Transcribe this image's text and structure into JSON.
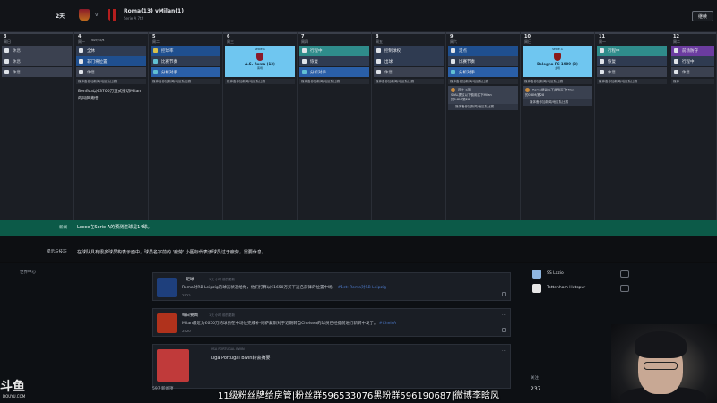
{
  "topbar": {
    "days": "2天",
    "vs": "v",
    "match_title": "Roma(13) vMilan(1)",
    "match_sub": "Serie A 7th",
    "button": "继续"
  },
  "calendar": {
    "days": [
      {
        "num": "3",
        "weekday": "周日",
        "date": "",
        "slots": [
          {
            "kind": "rest",
            "icon": "w",
            "label": "休息"
          },
          {
            "kind": "rest",
            "icon": "w",
            "label": "休息"
          },
          {
            "kind": "rest",
            "icon": "w",
            "label": "休息"
          }
        ],
        "notes": []
      },
      {
        "num": "4",
        "weekday": "周一",
        "date": "2027/10/5",
        "slots": [
          {
            "kind": "train",
            "icon": "w",
            "label": "全休"
          },
          {
            "kind": "dark",
            "icon": "w",
            "label": "非门将位置"
          },
          {
            "kind": "rest",
            "icon": "w",
            "label": "休息"
          }
        ],
        "notes": [
          "媒体备参加新闻/地区队比赛"
        ],
        "text": "Benfica以€3700万正式接切Milan的同萨藏惜"
      },
      {
        "num": "5",
        "weekday": "周二",
        "date": "",
        "slots": [
          {
            "kind": "dark",
            "icon": "y",
            "label": "控球率"
          },
          {
            "kind": "train",
            "icon": "c",
            "label": "比赛节奏"
          },
          {
            "kind": "blue",
            "icon": "c",
            "label": "分析对手"
          }
        ],
        "notes": [
          "媒体备参加新闻/地区队比赛"
        ]
      },
      {
        "num": "6",
        "weekday": "周三",
        "date": "",
        "card": {
          "top": "SERIE A",
          "name": "A.S. Roma (13)",
          "sub": "客场",
          "badge": "#8a1a2a"
        },
        "notes": [
          "媒体备参加新闻/地区队比赛"
        ]
      },
      {
        "num": "7",
        "weekday": "周四",
        "date": "",
        "slots": [
          {
            "kind": "teal",
            "icon": "w",
            "label": "行程中"
          },
          {
            "kind": "train",
            "icon": "w",
            "label": "恢复"
          },
          {
            "kind": "blue",
            "icon": "c",
            "label": "分析对手"
          }
        ],
        "notes": [
          "媒体备参加新闻/地区队比赛"
        ]
      },
      {
        "num": "8",
        "weekday": "周五",
        "date": "",
        "slots": [
          {
            "kind": "train",
            "icon": "w",
            "label": "控制球权"
          },
          {
            "kind": "train",
            "icon": "w",
            "label": "出球"
          },
          {
            "kind": "rest",
            "icon": "w",
            "label": "休息"
          }
        ],
        "notes": [
          "媒体备参加新闻/地区队比赛"
        ]
      },
      {
        "num": "9",
        "weekday": "周六",
        "date": "",
        "slots": [
          {
            "kind": "dark",
            "icon": "w",
            "label": "定点"
          },
          {
            "kind": "train",
            "icon": "w",
            "label": "比赛节奏"
          },
          {
            "kind": "blue",
            "icon": "c",
            "label": "分析对手"
          }
        ],
        "notes": [
          "媒体备参加新闻/地区队比赛"
        ],
        "injury": {
          "lines": [
            "预计 1周",
            "SPAL提议以下费用买下Milan",
            "的0.8M/第28"
          ],
          "foot": "媒体备参加新闻/地区队比赛"
        }
      },
      {
        "num": "10",
        "weekday": "周日",
        "date": "",
        "card": {
          "top": "SERIE A",
          "name": "Bologna FC 1909 (3)",
          "sub": "主场",
          "badge": "#8a1a1a"
        },
        "notes": [
          "媒体备参加新闻/地区队比赛"
        ],
        "injury": {
          "lines": [
            "Roma提议以下费用买下Milan",
            "的0.8M/第28"
          ],
          "foot": "媒体备参加新闻/地区队比赛"
        }
      },
      {
        "num": "11",
        "weekday": "周一",
        "date": "",
        "slots": [
          {
            "kind": "teal",
            "icon": "w",
            "label": "行程中"
          },
          {
            "kind": "train",
            "icon": "w",
            "label": "恢复"
          },
          {
            "kind": "rest",
            "icon": "w",
            "label": "休息"
          }
        ],
        "notes": [
          "媒体备参加新闻/地区队比赛"
        ]
      },
      {
        "num": "12",
        "weekday": "周二",
        "date": "",
        "slots": [
          {
            "kind": "purple",
            "icon": "w",
            "label": "前场防守"
          },
          {
            "kind": "train",
            "icon": "w",
            "label": "行程中"
          },
          {
            "kind": "rest",
            "icon": "w",
            "label": "休息"
          }
        ],
        "notes": [
          "媒体"
        ]
      }
    ]
  },
  "green_bar": {
    "label": "新闻",
    "text": "Lecce在Serie A的预测进球是14球。"
  },
  "tip_bar": {
    "label": "提示与技巧",
    "text": "在球队具有很多球员构表示面中，球员名字前的 '疲劳' 小图标代表该球员过于疲劳，需要休息。"
  },
  "news": {
    "header": "世界中心",
    "posts": [
      {
        "author": "一足球",
        "meta": "1天 小时 前的更新",
        "body": "Roma对RB Leipzig的球员状态给你，他们打算以€1650万买下这名前锋的位置中场。",
        "link": "#1st: Roma对RB Leipzig",
        "stats": "2522",
        "avatar": "#1e3f7c"
      },
      {
        "author": "每日要闻",
        "meta": "1天 小时 前的更新",
        "body": "Milan最近为€650万的球员在中场位完成补-同萨藏斯对于近期转自Chelsea的球员已经提前进行新转中发了。",
        "link": "#ChelsA",
        "stats": "2520",
        "avatar": "#b0321c"
      },
      {
        "author": "",
        "meta": "USA PORTUGAL BWIN",
        "body": "Liga Portugal Bwin转会摘要",
        "link": "",
        "stats": "",
        "avatar": "#c03a3a"
      }
    ],
    "count": "597 新闻项"
  },
  "side": {
    "items": [
      {
        "name": "SS Lazio",
        "color": "#8fb6e0"
      },
      {
        "name": "Tottenham Hotspur",
        "color": "#e6e6e6"
      }
    ],
    "label": "关注",
    "number": "237"
  },
  "stream": {
    "logo": "斗鱼",
    "logo_sub": "DOUYU.COM",
    "caption": "11级粉丝牌给房管|粉丝群596533076黑粉群596190687|微博李晗风"
  }
}
